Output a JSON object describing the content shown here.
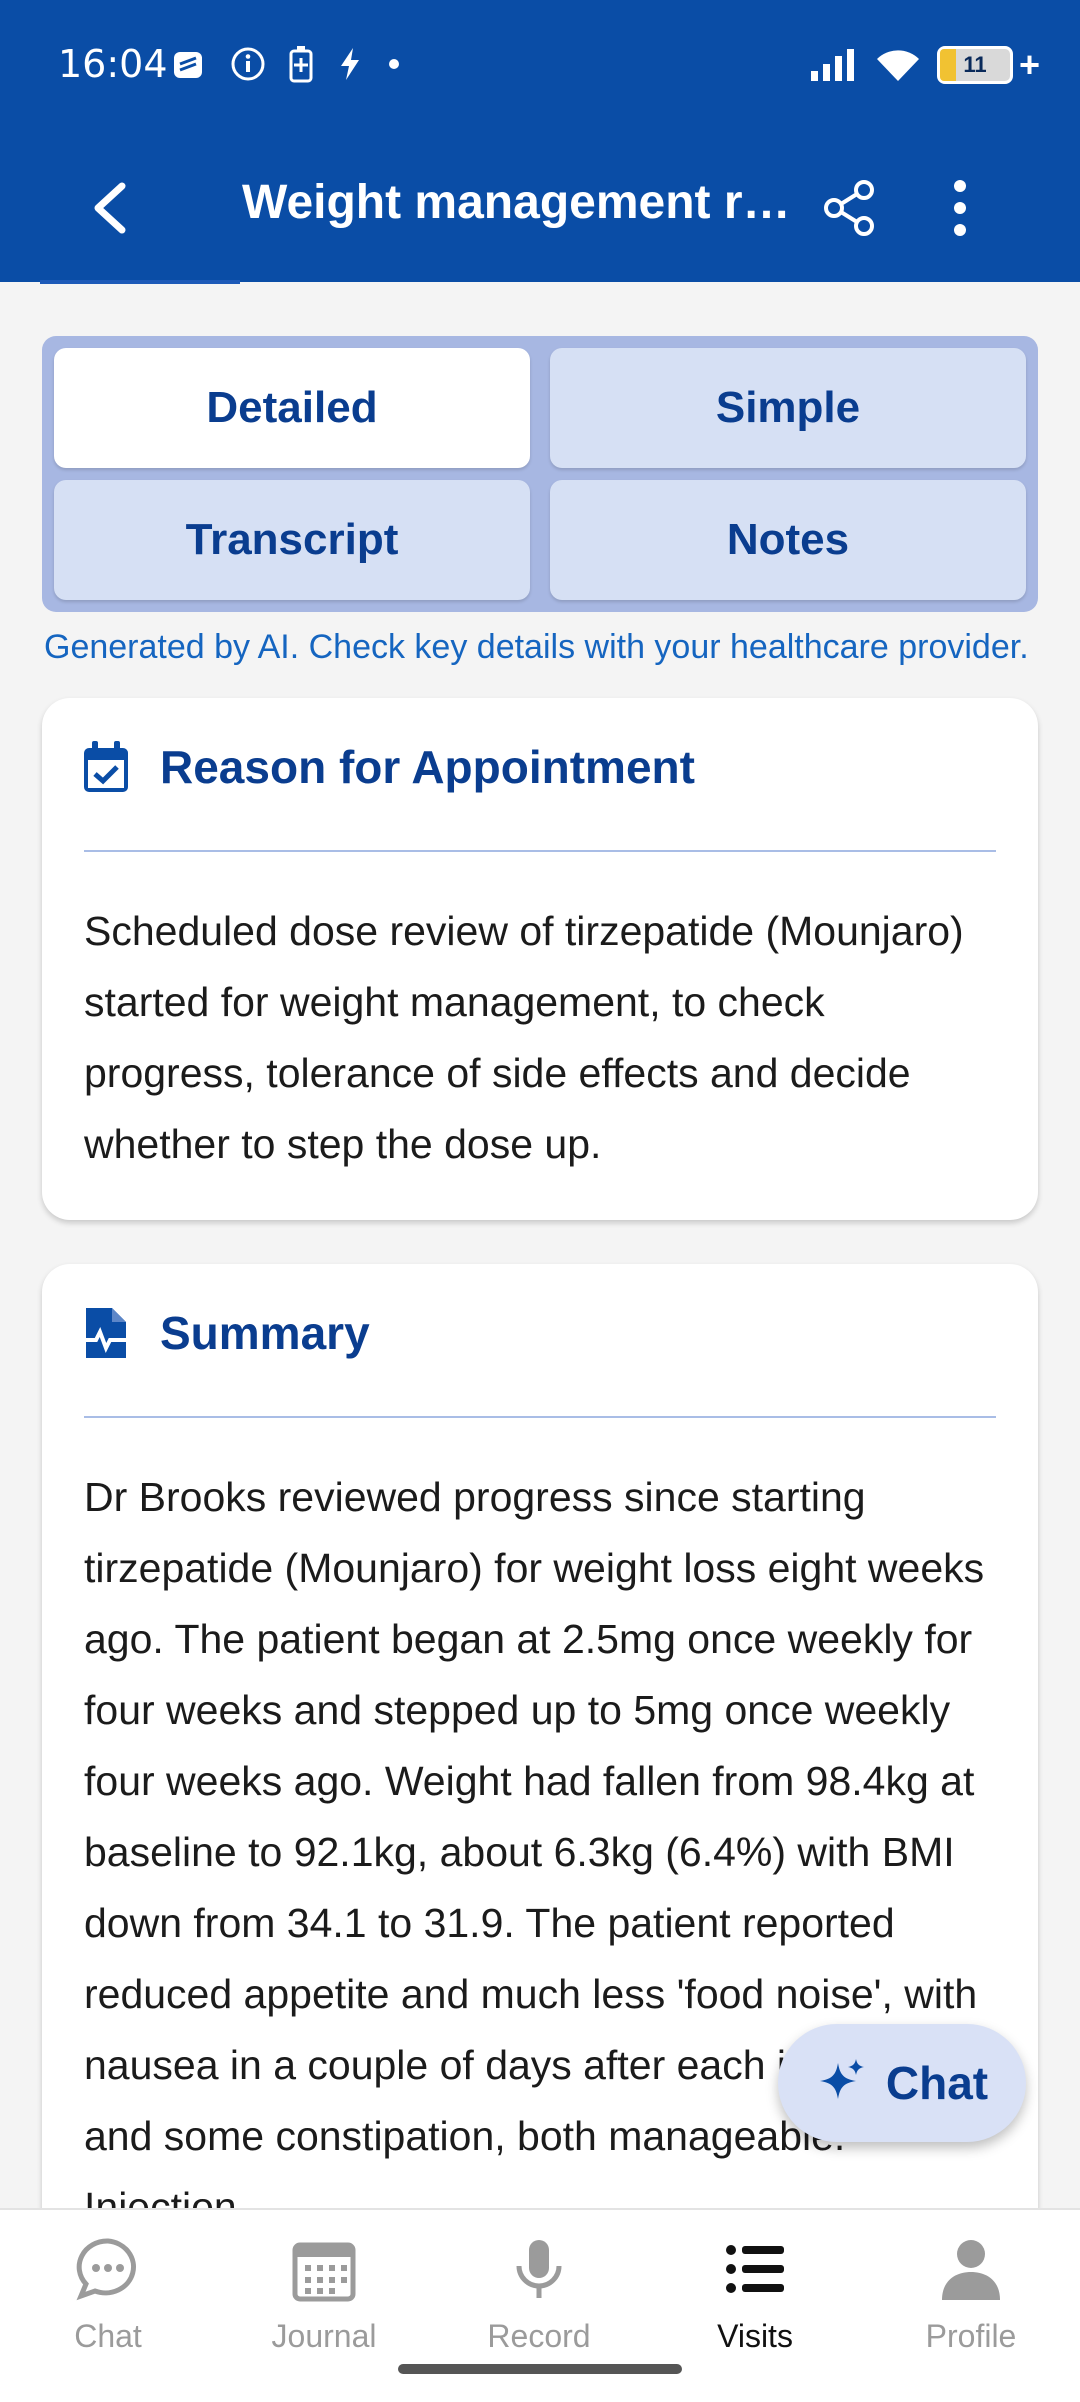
{
  "status": {
    "time": "16:04",
    "battery_level": "11",
    "battery_suffix": "+"
  },
  "appbar": {
    "title": "Weight management r…",
    "back_icon": "back-arrow-icon",
    "share_icon": "share-icon",
    "more_icon": "more-vertical-icon"
  },
  "tabs": [
    {
      "label": "Detailed",
      "active": true
    },
    {
      "label": "Simple",
      "active": false
    },
    {
      "label": "Transcript",
      "active": false
    },
    {
      "label": "Notes",
      "active": false
    }
  ],
  "disclaimer": "Generated by AI. Check key details with your healthcare provider.",
  "reason": {
    "title": "Reason for Appointment",
    "icon": "calendar-check-icon",
    "text": "Scheduled dose review of tirzepatide (Mounjaro) started for weight management, to check progress, tolerance of side effects and decide whether to step the dose up."
  },
  "summary": {
    "title": "Summary",
    "icon": "medical-file-icon",
    "text": "Dr Brooks reviewed progress since starting tirzepatide (Mounjaro) for weight loss eight weeks ago. The patient began at 2.5mg once weekly for four weeks and stepped up to 5mg once weekly four weeks ago. Weight had fallen from 98.4kg at baseline to 92.1kg, about 6.3kg (6.4%) with BMI down from 34.1 to 31.9. The patient reported reduced appetite and much less 'food noise', with nausea in a couple of days after each injection and some constipation, both manageable. Injection"
  },
  "fab": {
    "label": "Chat",
    "icon": "sparkle-icon"
  },
  "bottom_nav": [
    {
      "label": "Chat",
      "icon": "chat-bubble-icon",
      "active": false
    },
    {
      "label": "Journal",
      "icon": "calendar-icon",
      "active": false
    },
    {
      "label": "Record",
      "icon": "microphone-icon",
      "active": false
    },
    {
      "label": "Visits",
      "icon": "list-icon",
      "active": true
    },
    {
      "label": "Profile",
      "icon": "person-icon",
      "active": false
    }
  ],
  "colors": {
    "primary": "#0a4da6",
    "accent_text": "#0a3d8f",
    "link": "#1565c0"
  }
}
